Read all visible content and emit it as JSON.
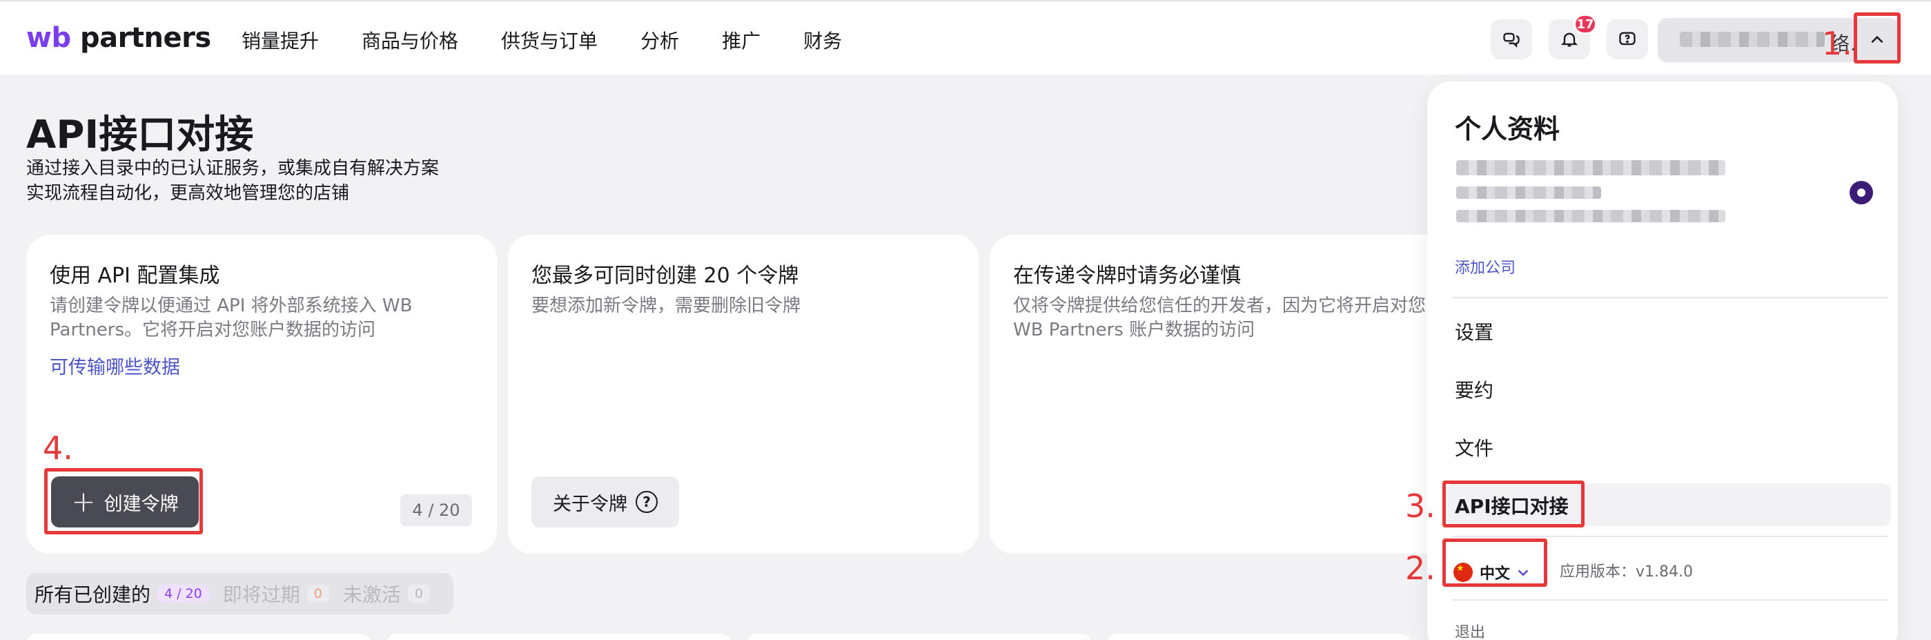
{
  "header": {
    "logo_wb": "wb",
    "logo_partners": " partners",
    "nav": [
      "销量提升",
      "商品与价格",
      "供货与订单",
      "分析",
      "推广",
      "财务"
    ],
    "notification_count": "17",
    "account_name_visible": "络..",
    "icons": [
      "chat-icon",
      "bell-icon",
      "help-icon",
      "chevron-up-icon"
    ]
  },
  "page": {
    "title": "API接口对接",
    "subtitle_line1": "通过接入目录中的已认证服务，或集成自有解决方案",
    "subtitle_line2": "实现流程自动化，更高效地管理您的店铺"
  },
  "cards": [
    {
      "title": "使用 API 配置集成",
      "text": "请创建令牌以便通过 API 将外部系统接入 WB Partners。它将开启对您账户数据的访问",
      "link": "可传输哪些数据",
      "button": "创建令牌",
      "counter": "4 / 20"
    },
    {
      "title": "您最多可同时创建 20 个令牌",
      "text": "要想添加新令牌，需要删除旧令牌",
      "button": "关于令牌"
    },
    {
      "title": "在传递令牌时请务必谨慎",
      "text": "仅将令牌提供给您信任的开发者，因为它将开启对您 WB Partners 账户数据的访问"
    }
  ],
  "tabs": [
    {
      "label": "所有已创建的",
      "count": "4 / 20"
    },
    {
      "label": "即将过期",
      "count": "0"
    },
    {
      "label": "未激活",
      "count": "0"
    }
  ],
  "menu": {
    "title": "个人资料",
    "add_company": "添加公司",
    "items": [
      "设置",
      "要约",
      "文件",
      "API接口对接"
    ],
    "language": "中文",
    "version": "应用版本：v1.84.0",
    "logout": "退出"
  },
  "annotations": [
    "1.",
    "2.",
    "3.",
    "4."
  ],
  "colors": {
    "accent": "#7a3ff0",
    "link": "#4b55c8",
    "annotation_red": "#e5383b",
    "badge": "#e8385a"
  }
}
